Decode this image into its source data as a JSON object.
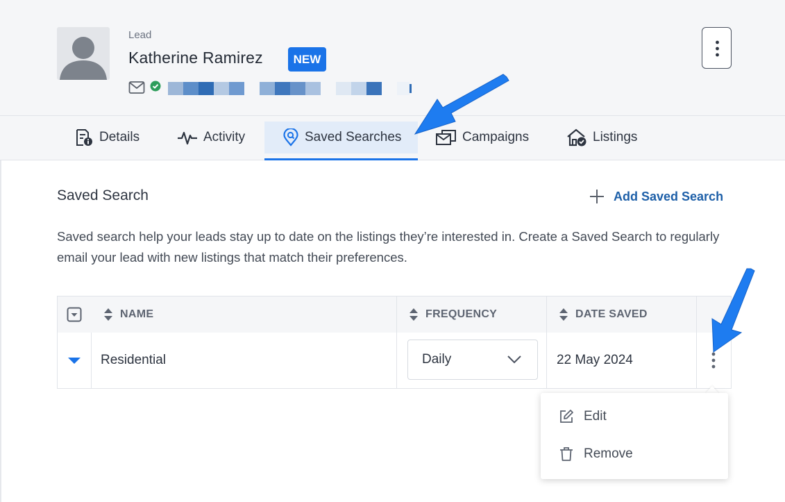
{
  "header": {
    "record_type": "Lead",
    "name": "Katherine Ramirez",
    "badge": "NEW",
    "icons": [
      "user-avatar-icon",
      "mail-icon",
      "verified-check-icon",
      "more-vertical-icon"
    ]
  },
  "tabs": [
    {
      "label": "Details",
      "icon": "details-doc-icon"
    },
    {
      "label": "Activity",
      "icon": "activity-pulse-icon"
    },
    {
      "label": "Saved Searches",
      "icon": "map-pin-search-icon",
      "active": true
    },
    {
      "label": "Campaigns",
      "icon": "campaign-mail-icon"
    },
    {
      "label": "Listings",
      "icon": "home-check-icon"
    }
  ],
  "section": {
    "title": "Saved Search",
    "add_label": "Add Saved Search",
    "description": "Saved search help your leads stay up to date on the listings they’re interested in. Create a Saved Search to regularly email your lead with new listings that match their preferences."
  },
  "table": {
    "columns": [
      "NAME",
      "FREQUENCY",
      "DATE SAVED"
    ],
    "rows": [
      {
        "name": "Residential",
        "frequency": "Daily",
        "date_saved": "22 May 2024"
      }
    ]
  },
  "row_menu": {
    "items": [
      {
        "label": "Edit",
        "icon": "edit-icon"
      },
      {
        "label": "Remove",
        "icon": "trash-icon"
      }
    ]
  },
  "colors": {
    "accent": "#1a73e8",
    "link": "#1d5fa8",
    "annotation_arrow": "#1e7cf0",
    "header_bg": "#f5f6f8"
  }
}
